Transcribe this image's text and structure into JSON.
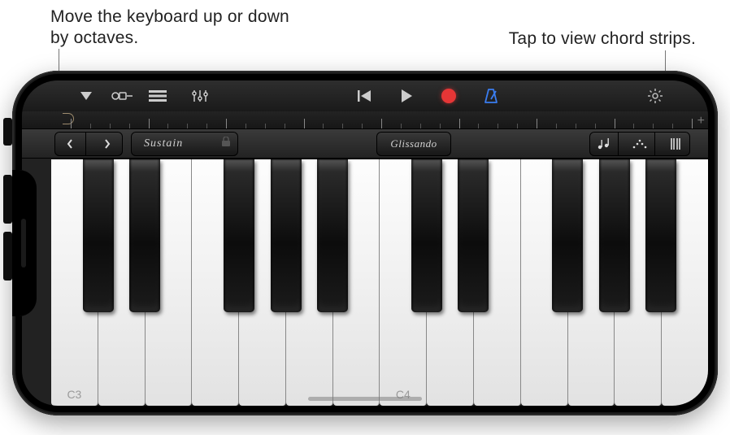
{
  "callouts": {
    "left": "Move the keyboard up or down by octaves.",
    "right": "Tap to view chord strips."
  },
  "toolbar": {
    "browser_icon": "instrument-browser",
    "fx_icon": "fx",
    "tracks_icon": "tracks",
    "mixer_icon": "mixer",
    "rewind_icon": "go-to-beginning",
    "play_icon": "play",
    "record_icon": "record",
    "metronome_icon": "metronome",
    "settings_icon": "settings"
  },
  "controls": {
    "octave_down": "octave-down",
    "octave_up": "octave-up",
    "sustain_label": "Sustain",
    "glissando_label": "Glissando",
    "keyboard_layout": "keyboard-layout",
    "arpeggiator": "arpeggiator",
    "chord_strips": "chord-strips"
  },
  "ruler": {
    "add_section": "+"
  },
  "keyboard": {
    "octave_labels": [
      "C3",
      "C4"
    ],
    "white_count": 14,
    "black_positions": [
      0,
      1,
      3,
      4,
      5,
      7,
      8,
      10,
      11,
      12
    ]
  }
}
